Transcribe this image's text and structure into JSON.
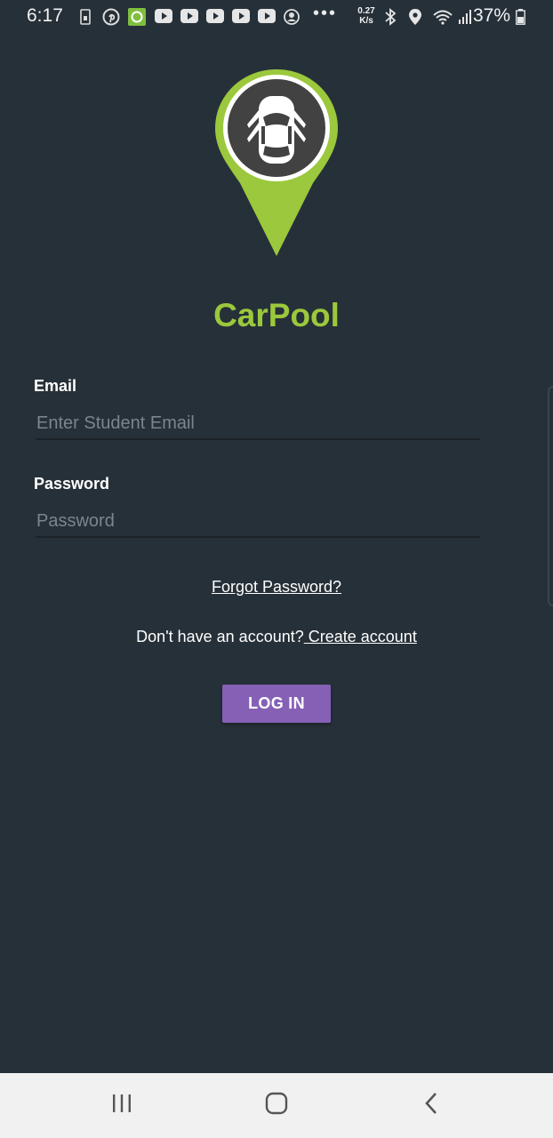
{
  "status_bar": {
    "time": "6:17",
    "network_speed_value": "0.27",
    "network_speed_unit": "K/s",
    "battery": "37%",
    "overflow": "•••",
    "icons": [
      "sim-data-icon",
      "pinterest-icon",
      "app-notification-icon",
      "youtube-icon",
      "youtube-icon",
      "youtube-icon",
      "youtube-icon",
      "youtube-icon",
      "account-icon",
      "bluetooth-icon",
      "location-icon",
      "wifi-icon",
      "signal-icon",
      "battery-icon"
    ]
  },
  "app": {
    "title": "CarPool",
    "logo_icon": "car-location-pin-icon",
    "accent_color": "#9bc83c"
  },
  "form": {
    "email_label": "Email",
    "email_placeholder": "Enter Student Email",
    "email_value": "",
    "password_label": "Password",
    "password_placeholder": "Password",
    "password_value": ""
  },
  "links": {
    "forgot_password": "Forgot Password?",
    "no_account_text": "Don't have an account?",
    "create_account": " Create account"
  },
  "login_button": {
    "label": "LOG IN",
    "color": "#8560b4"
  },
  "nav_bar": {
    "recents_icon": "recents-icon",
    "home_icon": "home-icon",
    "back_icon": "back-icon"
  }
}
